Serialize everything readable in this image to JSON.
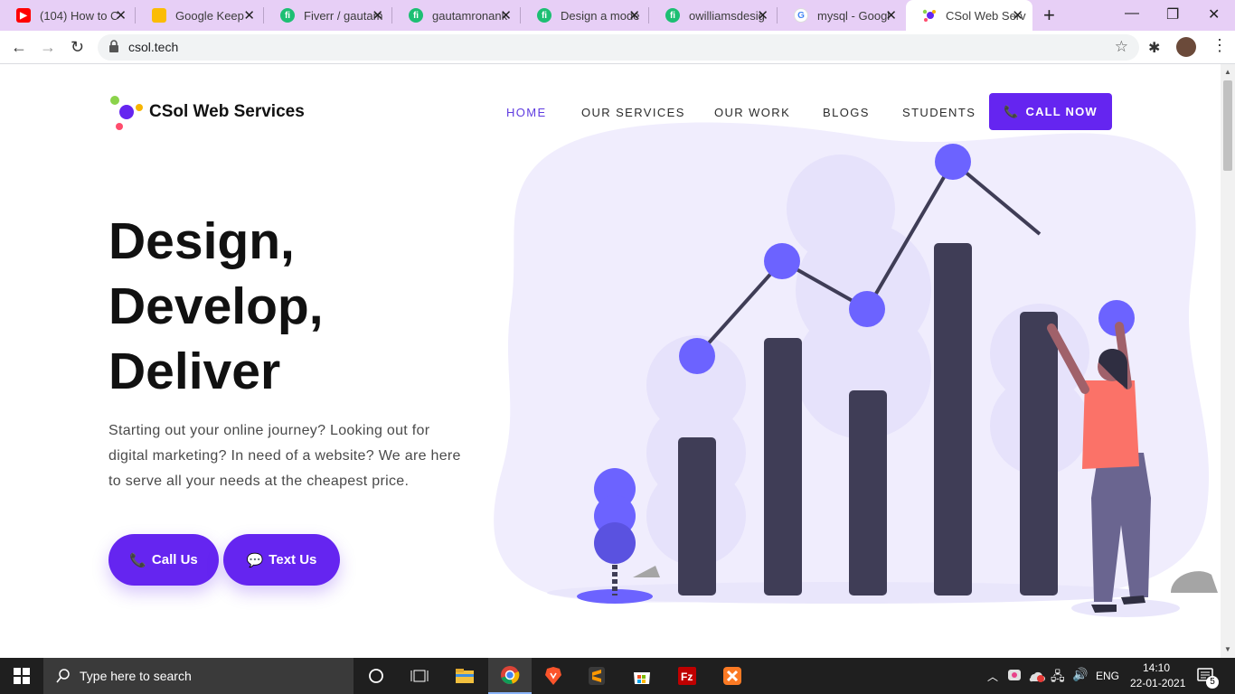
{
  "browser": {
    "tabs": [
      {
        "title": "(104) How to C",
        "icon": "youtube-icon",
        "color": "#ff0000",
        "active": false
      },
      {
        "title": "Google Keep",
        "icon": "keep-icon",
        "color": "#fbbc04",
        "active": false
      },
      {
        "title": "Fiverr / gautam",
        "icon": "fiverr-icon",
        "color": "#1dbf73",
        "active": false
      },
      {
        "title": "gautamronank",
        "icon": "fiverr-icon",
        "color": "#1dbf73",
        "active": false
      },
      {
        "title": "Design a mode",
        "icon": "fiverr-icon",
        "color": "#1dbf73",
        "active": false
      },
      {
        "title": "owilliamsdesig",
        "icon": "fiverr-icon",
        "color": "#1dbf73",
        "active": false
      },
      {
        "title": "mysql - Googl",
        "icon": "google-icon",
        "color": "#4285f4",
        "active": false
      },
      {
        "title": "CSol Web Serv",
        "icon": "csol-icon",
        "color": "#6525f0",
        "active": true
      }
    ],
    "url": "csol.tech"
  },
  "site": {
    "brand": "CSol Web Services",
    "nav": [
      {
        "label": "HOME",
        "active": true
      },
      {
        "label": "OUR SERVICES",
        "active": false
      },
      {
        "label": "OUR WORK",
        "active": false
      },
      {
        "label": "BLOGS",
        "active": false
      },
      {
        "label": "STUDENTS",
        "active": false
      }
    ],
    "call_now": "CALL NOW",
    "hero": {
      "line1": "Design,",
      "line2": "Develop,",
      "line3": "Deliver",
      "subtitle": "Starting out your online journey? Looking out for digital marketing? In need of a website? We are here to serve all your needs at the cheapest price.",
      "call_us": "Call Us",
      "text_us": "Text Us"
    },
    "accent": "#6525f0"
  },
  "taskbar": {
    "search_placeholder": "Type here to search",
    "language": "ENG",
    "time": "14:10",
    "date": "22-01-2021",
    "notifications": "5"
  }
}
